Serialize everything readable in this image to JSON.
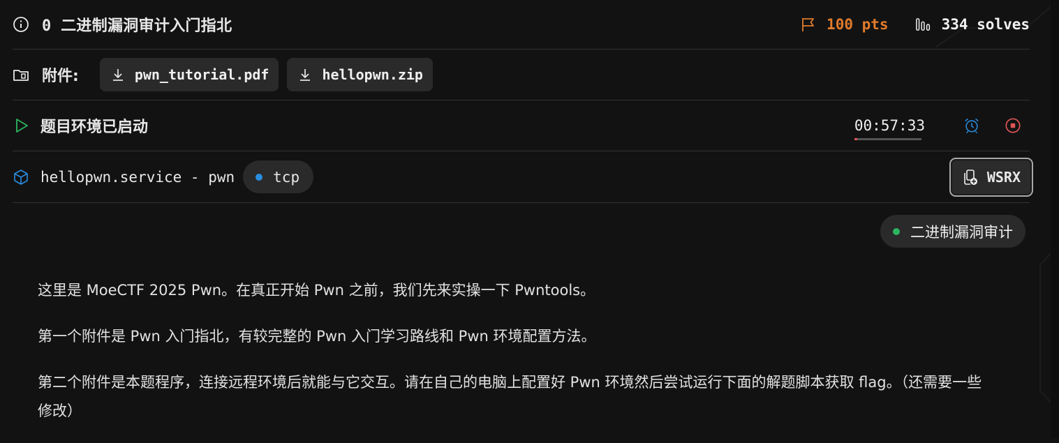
{
  "challenge": {
    "index": "0",
    "title": "二进制漏洞审计入门指北",
    "points": "100 pts",
    "solves": "334 solves",
    "colors": {
      "points": "#e07b2c",
      "accent_blue": "#2a8de0",
      "stop_red": "#e05555",
      "tag_green": "#2bb560"
    }
  },
  "attachments": {
    "label": "附件:",
    "files": [
      {
        "name": "pwn_tutorial.pdf",
        "icon": "download-icon"
      },
      {
        "name": "hellopwn.zip",
        "icon": "download-icon"
      }
    ]
  },
  "environment": {
    "status": "题目环境已启动",
    "timer": "00:57:33",
    "remaining_fraction": 0.04
  },
  "service": {
    "name": "hellopwn.service - pwn",
    "protocol": "tcp",
    "wsrx_label": "WSRX"
  },
  "tag": {
    "label": "二进制漏洞审计"
  },
  "description": {
    "paragraphs": [
      "这里是 MoeCTF 2025 Pwn。在真正开始 Pwn 之前，我们先来实操一下 Pwntools。",
      "第一个附件是 Pwn 入门指北，有较完整的 Pwn 入门学习路线和 Pwn 环境配置方法。",
      "第二个附件是本题程序，连接远程环境后就能与它交互。请在自己的电脑上配置好 Pwn 环境然后尝试运行下面的解题脚本获取 flag。（还需要一些修改）"
    ]
  }
}
